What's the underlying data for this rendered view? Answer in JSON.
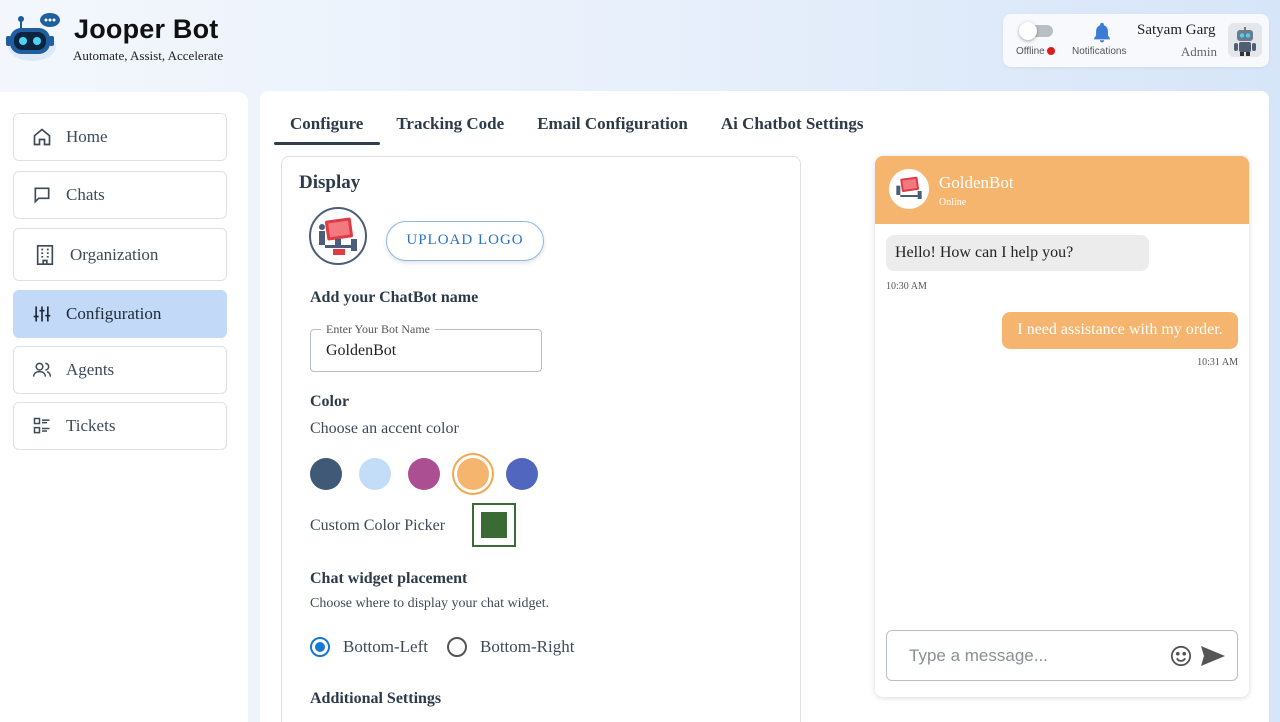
{
  "brand": {
    "name": "Jooper Bot",
    "tagline": "Automate, Assist, Accelerate",
    "logo_icon": "robot-logo-icon"
  },
  "header": {
    "status_label": "Offline",
    "status_color": "#e01b1b",
    "notifications_label": "Notifications",
    "user_name": "Satyam Garg",
    "user_role": "Admin"
  },
  "sidebar": {
    "items": [
      {
        "label": "Home",
        "icon": "home-icon",
        "active": false
      },
      {
        "label": "Chats",
        "icon": "chat-bubble-icon",
        "active": false
      },
      {
        "label": "Organization",
        "icon": "building-icon",
        "active": false
      },
      {
        "label": "Configuration",
        "icon": "sliders-icon",
        "active": true
      },
      {
        "label": "Agents",
        "icon": "users-icon",
        "active": false
      },
      {
        "label": "Tickets",
        "icon": "list-icon",
        "active": false
      }
    ]
  },
  "tabs": [
    {
      "label": "Configure",
      "active": true
    },
    {
      "label": "Tracking Code",
      "active": false
    },
    {
      "label": "Email Configuration",
      "active": false
    },
    {
      "label": "Ai Chatbot Settings",
      "active": false
    }
  ],
  "display": {
    "title": "Display",
    "upload_label": "UPLOAD LOGO",
    "name_heading": "Add your ChatBot name",
    "name_field_label": "Enter Your Bot Name",
    "name_field_value": "GoldenBot",
    "color_heading": "Color",
    "color_subtitle": "Choose an accent color",
    "swatches": [
      "#3f5977",
      "#c3dcf7",
      "#ab4f92",
      "#f6b56e",
      "#5066bf"
    ],
    "selected_swatch": "#f6b56e",
    "custom_picker_label": "Custom Color Picker",
    "custom_color": "#3a6b35",
    "placement_heading": "Chat widget placement",
    "placement_subtitle": "Choose where to display your chat widget.",
    "placement_options": [
      "Bottom-Left",
      "Bottom-Right"
    ],
    "placement_selected": "Bottom-Left",
    "additional_heading": "Additional Settings"
  },
  "preview": {
    "bot_name": "GoldenBot",
    "bot_status": "Online",
    "accent": "#f6b56e",
    "messages": [
      {
        "from": "bot",
        "text": "Hello! How can I help you?",
        "time": "10:30 AM"
      },
      {
        "from": "user",
        "text": "I need assistance with my order.",
        "time": "10:31 AM"
      }
    ],
    "input_placeholder": "Type a message..."
  }
}
